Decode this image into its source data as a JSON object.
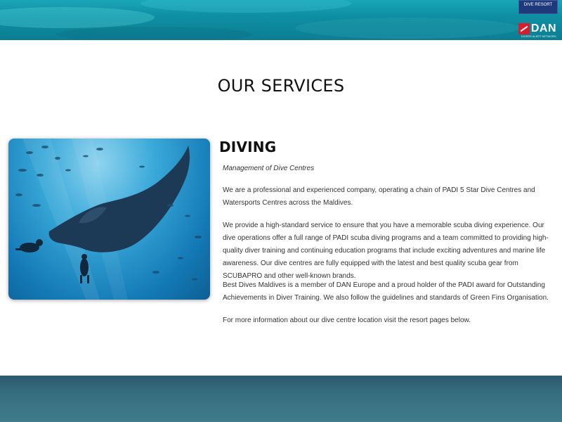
{
  "header": {
    "resort_logo_lines": [
      "DIVE RESORT"
    ],
    "dan_logo": "DAN",
    "dan_tagline": "DIVERS ALERT NETWORK"
  },
  "section": {
    "title": "OUR SERVICES"
  },
  "service": {
    "title": "DIVING",
    "subtitle": "Management of Dive Centres",
    "paragraphs": [
      "We are a professional and experienced company, operating a chain of PADI 5 Star Dive Centres and Watersports Centres across the Maldives.",
      "We provide a high-standard service to ensure that you have a memorable scuba diving experience. Our dive operations offer a full range of PADI scuba diving programs and a team committed to providing high-quality diver training and continuing education programs that include exciting adventures and marine life awareness. Our dive centres are fully equipped with the latest and best quality scuba gear from SCUBAPRO and other well-known brands.",
      "Best Dives Maldives is a member of DAN Europe and a proud holder of the PADI award for Outstanding Achievements in Diver Training. We also follow the guidelines and standards of Green Fins Organisation.",
      "For more information about our dive centre location visit the resort pages below."
    ]
  },
  "colors": {
    "banner_top": "#1aa6b8",
    "banner_bottom": "#376e80",
    "dan_red": "#d81e2c"
  }
}
